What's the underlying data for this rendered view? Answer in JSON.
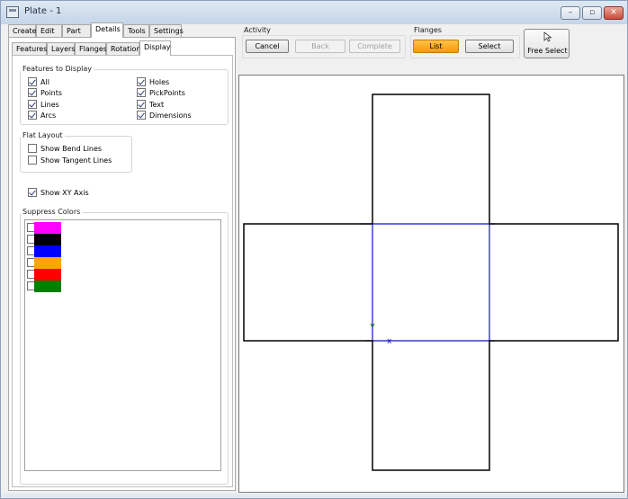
{
  "window": {
    "title": "Plate - 1",
    "controls": {
      "minimize": "–",
      "maximize": "▫",
      "close": "✕"
    }
  },
  "main_tabs": [
    "Create",
    "Edit",
    "Part",
    "Details",
    "Tools",
    "Settings"
  ],
  "sub_tabs": [
    "Features",
    "Layers",
    "Flanges",
    "Rotation",
    "Display"
  ],
  "features_to_display": {
    "label": "Features to Display",
    "items": [
      {
        "label": "All",
        "checked": true
      },
      {
        "label": "Holes",
        "checked": true
      },
      {
        "label": "Points",
        "checked": true
      },
      {
        "label": "PickPoints",
        "checked": true
      },
      {
        "label": "Lines",
        "checked": true
      },
      {
        "label": "Text",
        "checked": true
      },
      {
        "label": "Arcs",
        "checked": true
      },
      {
        "label": "Dimensions",
        "checked": true
      }
    ]
  },
  "flat_layout": {
    "label": "Flat Layout",
    "items": [
      {
        "label": "Show Bend Lines",
        "checked": false
      },
      {
        "label": "Show Tangent Lines",
        "checked": false
      }
    ]
  },
  "show_xy_axis": {
    "label": "Show XY Axis",
    "checked": true
  },
  "suppress_colors": {
    "label": "Suppress Colors",
    "colors": [
      "#ff00ff",
      "#000000",
      "#0000ff",
      "#ffa500",
      "#ff0000",
      "#008000"
    ]
  },
  "activity": {
    "label": "Activity",
    "cancel": "Cancel",
    "back": "Back",
    "complete": "Complete"
  },
  "flanges": {
    "label": "Flanges",
    "list": "List",
    "select": "Select"
  },
  "free_select": {
    "label": "Free Select"
  },
  "canvas": {
    "axis_marker": "x",
    "axis_color": "#1010c8"
  }
}
